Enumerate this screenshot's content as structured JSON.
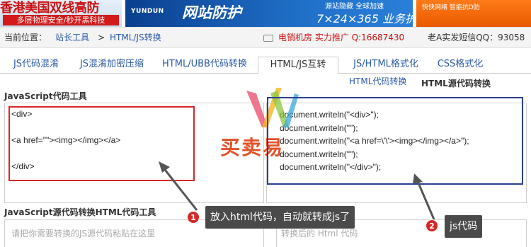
{
  "banner": {
    "ad_left_line1": "香港美国双线高防",
    "ad_left_line2": "多层物理安全/秒开黑科技",
    "ad_mid_logo": "YUNDUN",
    "ad_mid_title": "网站防护",
    "ad_mid_sub": "源站隐藏  全球加速",
    "ad_mid_service": "7×24×365 业务护航",
    "ad_right_text": "快快网络 智能抗D防"
  },
  "breadcrumb": {
    "current_label": "当前位置：",
    "item1": "站长工具",
    "separator": ">",
    "item2": "HTML/JS转换",
    "promo": "电销机房 实力推广 Q:16687430",
    "qq_text": "老A实发短信QQ：93058"
  },
  "tabs": [
    "JS代码混淆",
    "JS混淆加密压缩",
    "HTML/UBB代码转换",
    "HTML/JS互转",
    "JS/HTML格式化",
    "CSS格式化"
  ],
  "active_tab": "HTML/JS互转",
  "subtabs": [
    "HTML代码转换",
    "HTML源代码转换"
  ],
  "section1_title": "JavaScript代码工具",
  "left_code": "<div>\n\n<a href=\"\"><img></img></a>\n\n</div>",
  "right_code": "document.writeln(\"<div>\");\ndocument.writeln(\"\");\ndocument.writeln(\"<a href=\\'\\'><img></img></a>\");\ndocument.writeln(\"\");\ndocument.writeln(\"</div>\");",
  "section2_title": "JavaScript源代码转换HTML代码工具",
  "input_placeholder_left": "请把你需要转换的JS源代码粘贴在这里",
  "input_placeholder_right": "转换后的 Html 代码",
  "annotation1": {
    "number": "1",
    "text": "放入html代码，自动就转成js了"
  },
  "annotation2": {
    "number": "2",
    "text": "js代码"
  },
  "watermark_text": "买卖易",
  "colors": {
    "link": "#2a5aa8",
    "red_box": "#d62828",
    "blue_box": "#2a3f95",
    "callout_bg": "#4a4a4a",
    "promo_red": "#cc1111"
  }
}
